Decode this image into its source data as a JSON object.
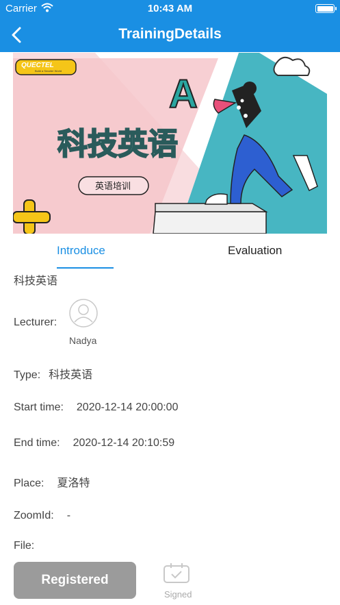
{
  "status_bar": {
    "carrier": "Carrier",
    "time": "10:43 AM"
  },
  "nav": {
    "title": "TrainingDetails"
  },
  "banner": {
    "brand": "QUECTEL",
    "brand_tagline": "Build a Smarter World",
    "title_cn": "科技英语",
    "subtitle_cn": "英语培训"
  },
  "tabs": {
    "introduce": "Introduce",
    "evaluation": "Evaluation"
  },
  "course": {
    "name": "科技英语",
    "lecturer_label": "Lecturer:",
    "lecturer_name": "Nadya",
    "type_label": "Type:",
    "type_value": "科技英语",
    "start_label": "Start time:",
    "start_value": "2020-12-14 20:00:00",
    "end_label": "End time:",
    "end_value": "2020-12-14 20:10:59",
    "place_label": "Place:",
    "place_value": "夏洛特",
    "zoom_label": "ZoomId:",
    "zoom_value": "-",
    "file_label": "File:"
  },
  "actions": {
    "register_label": "Registered",
    "signed_label": "Signed"
  },
  "colors": {
    "accent": "#1a8fe3",
    "button_gray": "#9b9b9b"
  }
}
